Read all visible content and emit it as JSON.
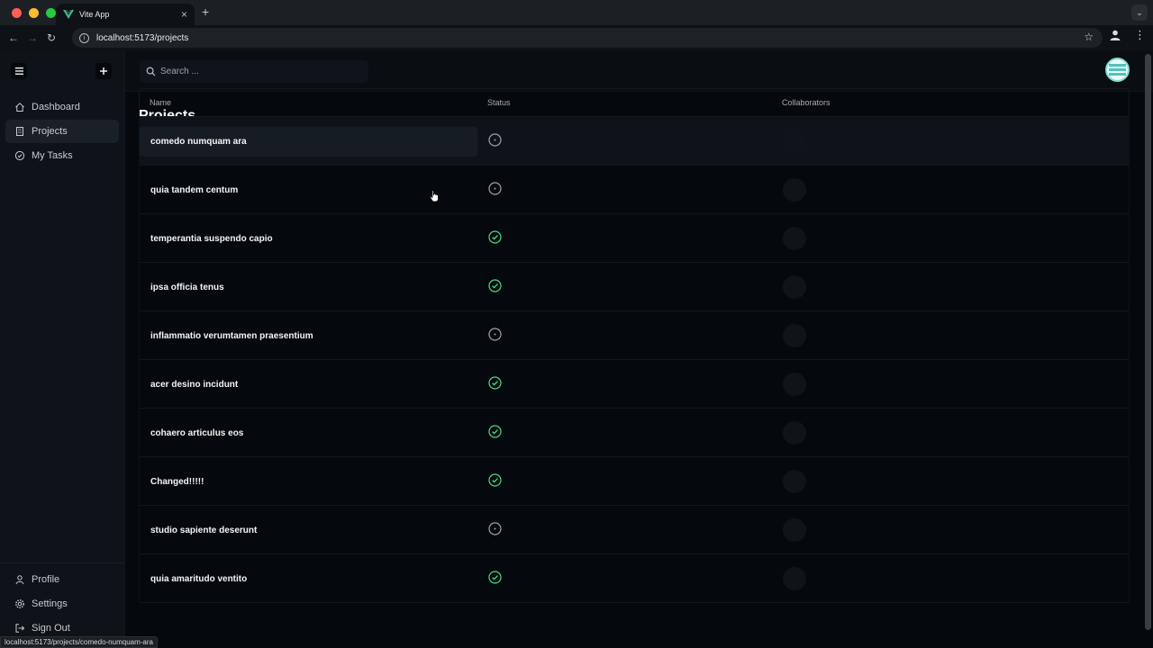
{
  "browser": {
    "tab_title": "Vite App",
    "url": "localhost:5173/projects",
    "status_url": "localhost:5173/projects/comedo-numquam-ara"
  },
  "sidebar": {
    "nav": [
      {
        "label": "Dashboard",
        "icon": "home-icon"
      },
      {
        "label": "Projects",
        "icon": "building-icon",
        "active": true
      },
      {
        "label": "My Tasks",
        "icon": "check-circle-icon"
      }
    ],
    "bottom": [
      {
        "label": "Profile",
        "icon": "user-icon"
      },
      {
        "label": "Settings",
        "icon": "gear-icon"
      },
      {
        "label": "Sign Out",
        "icon": "sign-out-icon"
      }
    ]
  },
  "header": {
    "search_placeholder": "Search ..."
  },
  "page": {
    "title": "Projects",
    "columns": {
      "name": "Name",
      "status": "Status",
      "collaborators": "Collaborators"
    },
    "rows": [
      {
        "name": "comedo numquam ara",
        "status": "in-progress"
      },
      {
        "name": "quia tandem centum",
        "status": "in-progress"
      },
      {
        "name": "temperantia suspendo capio",
        "status": "completed"
      },
      {
        "name": "ipsa officia tenus",
        "status": "completed"
      },
      {
        "name": "inflammatio verumtamen praesentium",
        "status": "in-progress"
      },
      {
        "name": "acer desino incidunt",
        "status": "completed"
      },
      {
        "name": "cohaero articulus eos",
        "status": "completed"
      },
      {
        "name": "Changed!!!!!",
        "status": "completed"
      },
      {
        "name": "studio sapiente deserunt",
        "status": "in-progress"
      },
      {
        "name": "quia amaritudo ventito",
        "status": "completed"
      }
    ]
  },
  "colors": {
    "completed": "#4ade80",
    "in_progress": "#9ca3af",
    "accent": "#42b883"
  }
}
